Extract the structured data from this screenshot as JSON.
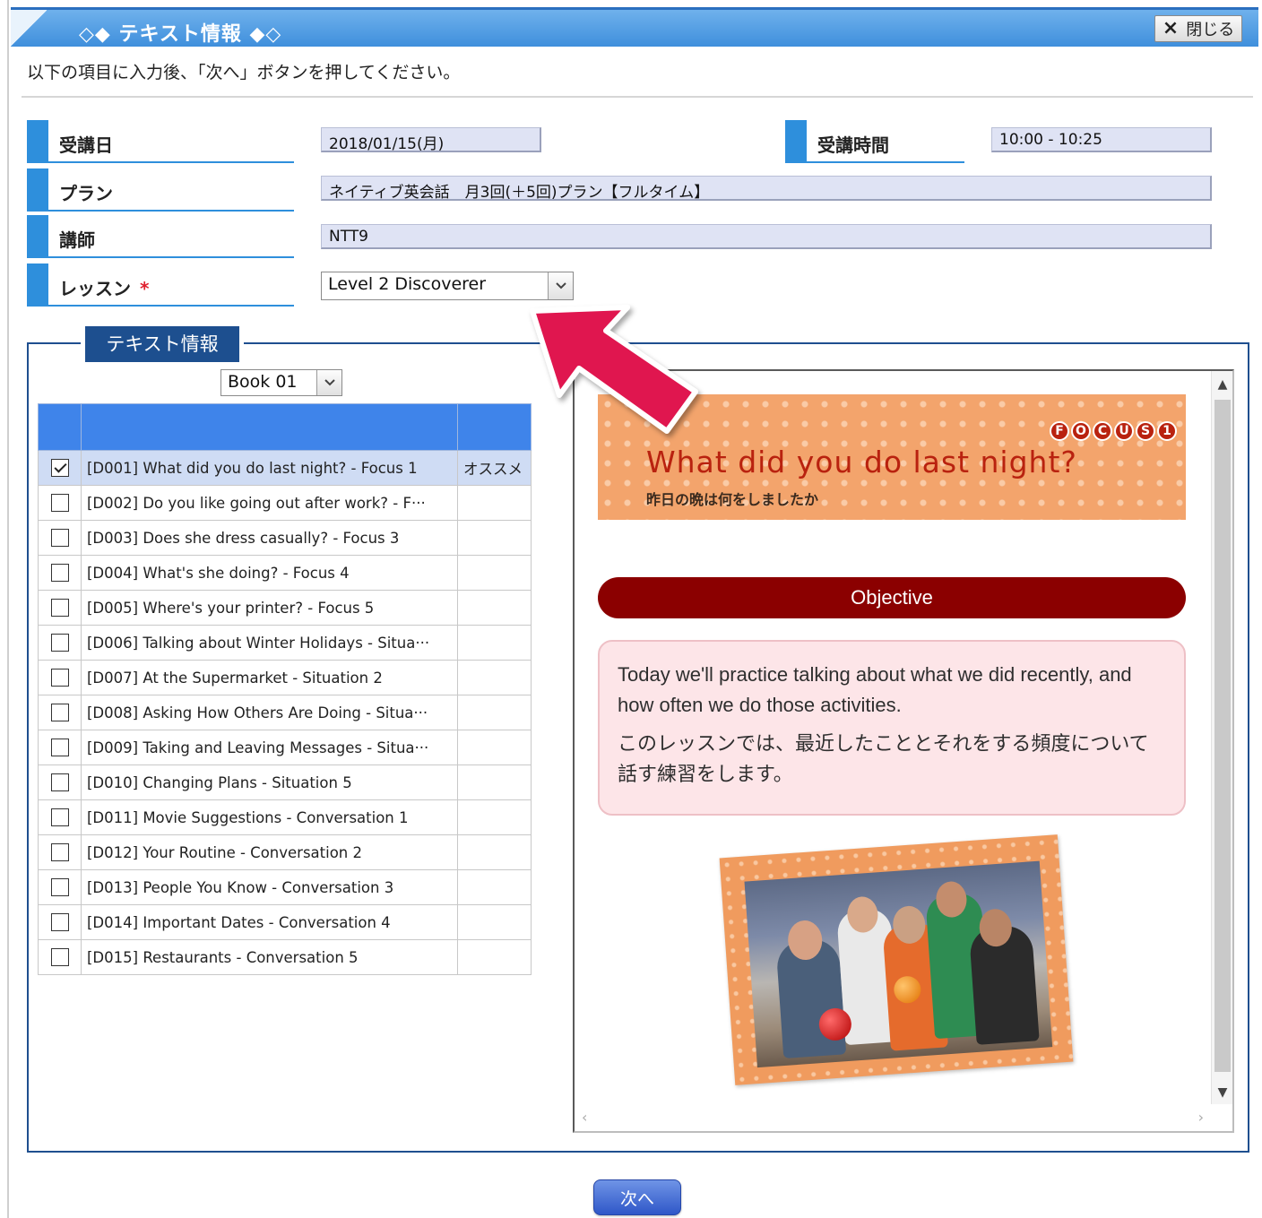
{
  "window": {
    "title": "◇◆ テキスト情報 ◆◇",
    "close_label": "閉じる",
    "close_icon": "×"
  },
  "instruction": "以下の項目に入力後、「次へ」ボタンを押してください。",
  "form": {
    "date_label": "受講日",
    "date_value": "2018/01/15(月)",
    "time_label": "受講時間",
    "time_value": "10:00 - 10:25",
    "plan_label": "プラン",
    "plan_value": "ネイティブ英会話　月3回(＋5回)プラン【フルタイム】",
    "teacher_label": "講師",
    "teacher_value": "NTT9",
    "lesson_label": "レッスン",
    "lesson_required": "*",
    "lesson_selected": "Level 2 Discoverer"
  },
  "text_info": {
    "legend": "テキスト情報",
    "book_selected": "Book 01",
    "rows": [
      {
        "label": "[D001] What did you do last night? - Focus 1",
        "note": "オススメ",
        "checked": true
      },
      {
        "label": "[D002] Do you like going out after work? - F···",
        "note": "",
        "checked": false
      },
      {
        "label": "[D003] Does she dress casually? - Focus 3",
        "note": "",
        "checked": false
      },
      {
        "label": "[D004] What's she doing? - Focus 4",
        "note": "",
        "checked": false
      },
      {
        "label": "[D005] Where's your printer? - Focus 5",
        "note": "",
        "checked": false
      },
      {
        "label": "[D006] Talking about Winter Holidays - Situa···",
        "note": "",
        "checked": false
      },
      {
        "label": "[D007] At the Supermarket - Situation 2",
        "note": "",
        "checked": false
      },
      {
        "label": "[D008] Asking How Others Are Doing - Situa···",
        "note": "",
        "checked": false
      },
      {
        "label": "[D009] Taking and Leaving Messages - Situa···",
        "note": "",
        "checked": false
      },
      {
        "label": "[D010] Changing Plans - Situation 5",
        "note": "",
        "checked": false
      },
      {
        "label": "[D011] Movie Suggestions - Conversation 1",
        "note": "",
        "checked": false
      },
      {
        "label": "[D012] Your Routine - Conversation 2",
        "note": "",
        "checked": false
      },
      {
        "label": "[D013] People You Know - Conversation 3",
        "note": "",
        "checked": false
      },
      {
        "label": "[D014] Important Dates - Conversation 4",
        "note": "",
        "checked": false
      },
      {
        "label": "[D015] Restaurants - Conversation 5",
        "note": "",
        "checked": false
      }
    ]
  },
  "preview": {
    "focus_badge": [
      "F",
      "O",
      "C",
      "U",
      "S",
      "1"
    ],
    "banner_title": "What did you do last night?",
    "banner_subtitle": "昨日の晩は何をしましたか",
    "objective_heading": "Objective",
    "objective_en": "Today we'll practice talking about what we did recently, and how often we do those activities.",
    "objective_ja": "このレッスンでは、最近したこととそれをする頻度について話す練習をします。"
  },
  "next_button": "次へ",
  "colors": {
    "accent_blue": "#2e8fdc",
    "table_header": "#3f84ea",
    "objective_red": "#8b0000",
    "banner_orange": "#f3a46c",
    "arrow_pink": "#e0154f"
  },
  "icons": {
    "close": "close-icon",
    "dropdown": "chevron-down-icon",
    "pointer": "arrow-pointer-icon"
  }
}
